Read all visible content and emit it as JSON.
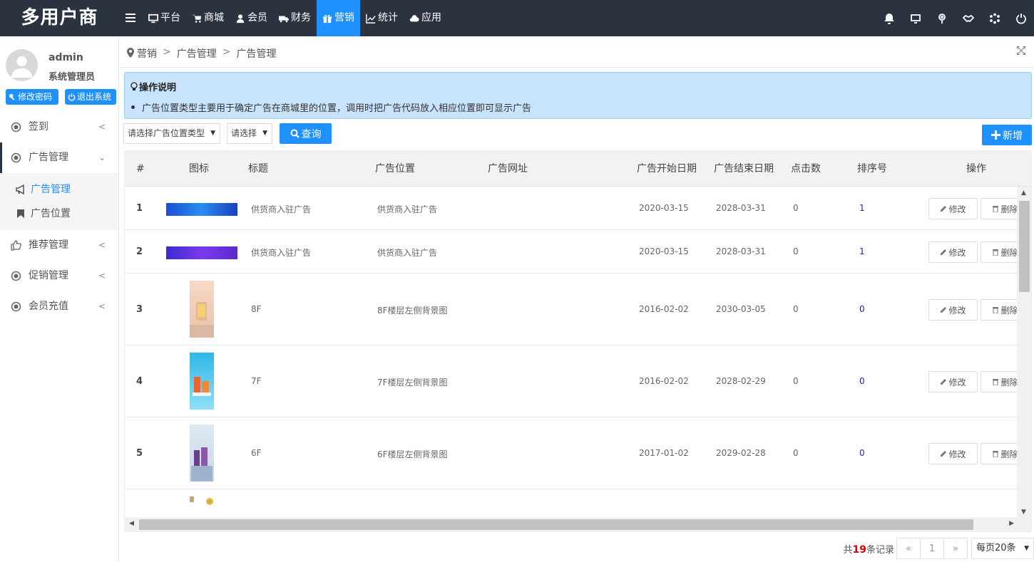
{
  "brand": {
    "logo": "多用户商"
  },
  "nav": {
    "items": [
      {
        "label": "平台",
        "icon": "desktop-icon"
      },
      {
        "label": "商城",
        "icon": "cart-icon"
      },
      {
        "label": "会员",
        "icon": "user-icon"
      },
      {
        "label": "财务",
        "icon": "truck-icon"
      },
      {
        "label": "营销",
        "icon": "gift-icon",
        "active": true
      },
      {
        "label": "统计",
        "icon": "chart-icon"
      },
      {
        "label": "应用",
        "icon": "cloud-icon"
      }
    ]
  },
  "topbar_icons": [
    "bell-icon",
    "monitor-icon",
    "location-icon",
    "handshake-icon",
    "spinner-icon",
    "power-icon"
  ],
  "user": {
    "name": "admin",
    "role": "系统管理员",
    "change_password": "修改密码",
    "logout": "退出系统"
  },
  "sidebar": {
    "items": [
      {
        "label": "签到",
        "icon": "circle-dot-icon"
      },
      {
        "label": "广告管理",
        "icon": "circle-dot-icon",
        "open": true
      },
      {
        "label": "推荐管理",
        "icon": "thumbs-up-icon"
      },
      {
        "label": "促销管理",
        "icon": "circle-dot-icon"
      },
      {
        "label": "会员充值",
        "icon": "circle-dot-icon"
      }
    ],
    "subitems": [
      {
        "label": "广告管理",
        "icon": "bullhorn-icon",
        "active": true
      },
      {
        "label": "广告位置",
        "icon": "bookmark-icon"
      }
    ]
  },
  "breadcrumb": {
    "root": "营销",
    "level1": "广告管理",
    "level2": "广告管理",
    "sep": ">"
  },
  "tips": {
    "title": "操作说明",
    "text": "广告位置类型主要用于确定广告在商城里的位置，调用时把广告代码放入相应位置即可显示广告"
  },
  "filters": {
    "type_select": "请选择广告位置类型",
    "second_select": "请选择",
    "search_label": "查询",
    "add_label": "新增"
  },
  "table": {
    "headers": [
      "#",
      "图标",
      "标题",
      "广告位置",
      "广告网址",
      "广告开始日期",
      "广告结束日期",
      "点击数",
      "排序号",
      "操作"
    ],
    "edit_label": "修改",
    "delete_label": "删除",
    "rows": [
      {
        "num": "1",
        "title": "供货商入驻广告",
        "position": "供货商入驻广告",
        "url": "",
        "start": "2020-03-15",
        "end": "2028-03-31",
        "clicks": "0",
        "sort": "1",
        "img": "wide-blue"
      },
      {
        "num": "2",
        "title": "供货商入驻广告",
        "position": "供货商入驻广告",
        "url": "",
        "start": "2020-03-15",
        "end": "2028-03-31",
        "clicks": "0",
        "sort": "1",
        "img": "wide-purple"
      },
      {
        "num": "3",
        "title": "8F",
        "position": "8F楼层左侧背景图",
        "url": "",
        "start": "2016-02-02",
        "end": "2030-03-05",
        "clicks": "0",
        "sort": "0",
        "img": "tall-peach"
      },
      {
        "num": "4",
        "title": "7F",
        "position": "7F楼层左侧背景图",
        "url": "",
        "start": "2016-02-02",
        "end": "2028-02-29",
        "clicks": "0",
        "sort": "0",
        "img": "tall-cyan"
      },
      {
        "num": "5",
        "title": "6F",
        "position": "6F楼层左侧背景图",
        "url": "",
        "start": "2017-01-02",
        "end": "2029-02-28",
        "clicks": "0",
        "sort": "0",
        "img": "tall-lavender"
      }
    ]
  },
  "pagination": {
    "total_prefix": "共",
    "total": "19",
    "total_suffix": "条记录",
    "prev": "«",
    "current": "1",
    "next": "»",
    "page_size": "每页20条"
  },
  "colors": {
    "topbar": "#2b3340",
    "accent": "#1e90ff",
    "tips_bg": "#c8e3fc"
  }
}
